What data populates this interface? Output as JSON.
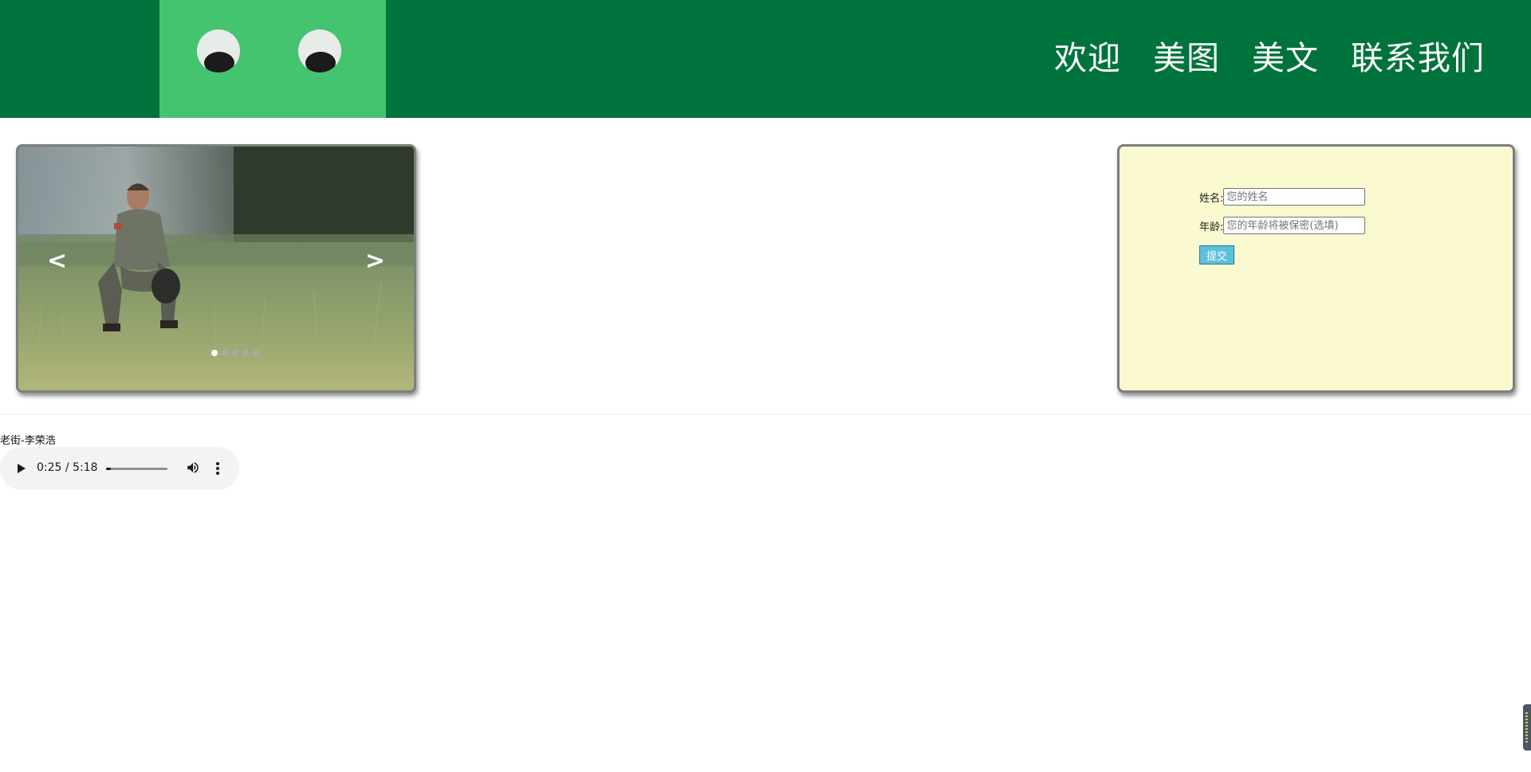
{
  "header": {
    "nav": [
      {
        "label": "欢迎"
      },
      {
        "label": "美图"
      },
      {
        "label": "美文"
      },
      {
        "label": "联系我们"
      }
    ]
  },
  "slider": {
    "prev_label": "<",
    "next_label": ">",
    "dot_count": 5,
    "active_index": 0
  },
  "form": {
    "name_label": "姓名:",
    "name_placeholder": "您的姓名",
    "age_label": "年龄:",
    "age_placeholder": "您的年龄将被保密(选填)",
    "submit_label": "提交"
  },
  "audio": {
    "title": "老街-李荣浩",
    "time": "0:25 / 5:18",
    "progress": 0.08
  },
  "colors": {
    "header_bg": "#00733d",
    "logo_bg": "#45c46f",
    "form_bg": "#fbf9d0",
    "submit_bg": "#5bc0de"
  }
}
